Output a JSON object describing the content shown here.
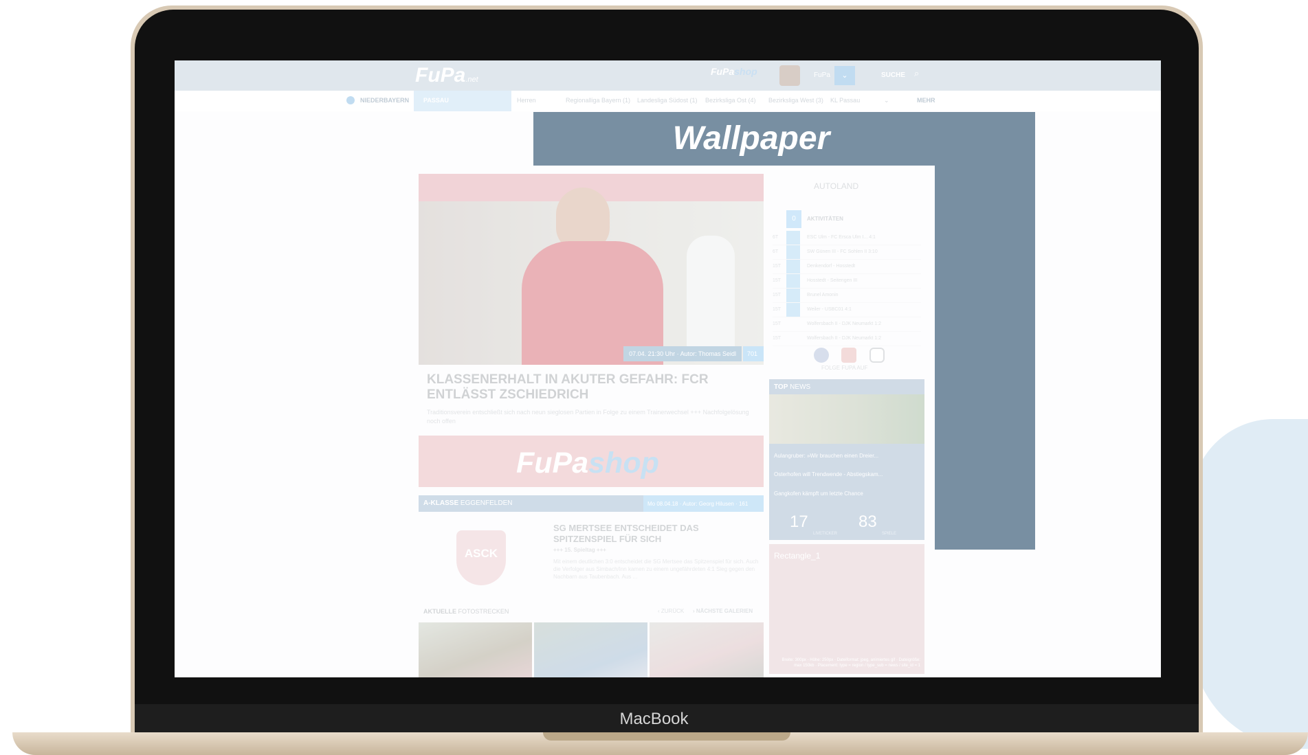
{
  "device": {
    "brand": "MacBook"
  },
  "header": {
    "logo_text": "FuPa",
    "logo_suffix": ".net",
    "shop_logo": [
      "FuPa",
      "shop"
    ],
    "user_label": "FuPa",
    "search_label": "SUCHE"
  },
  "subnav": {
    "region": "NIEDERBAYERN",
    "active": "PASSAU",
    "items": [
      "Herren",
      "Regionalliga Bayern (1)",
      "Landesliga Südost (1)",
      "Bezirksliga Ost (4)",
      "Bezirksliga West (3)",
      "KL Passau"
    ],
    "more": "MEHR"
  },
  "wallpaper": {
    "title": "Wallpaper"
  },
  "hero": {
    "meta": "07.04. 21:30 Uhr · Autor: Thomas Seidl",
    "meta_count": "701",
    "headline": "KLASSENERHALT IN AKUTER GEFAHR: FCR ENTLÄSST ZSCHIEDRICH",
    "teaser": "Traditionsverein entschließt sich nach neun sieglosen Partien in Folge zu einem Trainerwechsel +++ Nachfolgelösung noch offen"
  },
  "shop_banner": [
    "FuPa",
    "shop"
  ],
  "league": {
    "name_bold": "A-KLASSE",
    "name": "EGGENFELDEN",
    "info": "Mo 08.04.18 · Autor: Georg Hilusen · 161"
  },
  "article": {
    "badge": "ASCK",
    "title": "SG MERTSEE ENTSCHEIDET DAS SPITZENSPIEL FÜR SICH",
    "sub": "+++ 15. Spieltag +++",
    "text": "Mit einem deutlichen 3:0 entscheidet die SG Mertsee das Spitzenspiel für sich. Auch die Verfolger aus Simbach/Inn kamen zu einem ungefährdeten 4:1 Sieg gegen den Nachbarn aus Taubenbach. Aus ..."
  },
  "gallery": {
    "title_bold": "AKTUELLE",
    "title": "FOTOSTRECKEN",
    "back": "‹ ZURÜCK",
    "next": "› NÄCHSTE GALERIEN"
  },
  "sidebar": {
    "sponsor": "AUTOLAND",
    "activity_count": "0",
    "activity_label": "AKTIVITÄTEN",
    "activities": [
      {
        "time": "6T",
        "text": "ESC Ulm - FC Ersca Ulm I... 4:1"
      },
      {
        "time": "6T",
        "text": "SW Günen III - FC Sohlen II 3:10"
      },
      {
        "time": "15T",
        "text": "Denkendorf - Hosstedt"
      },
      {
        "time": "15T",
        "text": "Hosstedt - Seitengen III"
      },
      {
        "time": "15T",
        "text": "Brunel Amonin"
      },
      {
        "time": "15T",
        "text": "Weiler - USBC01 4:1"
      },
      {
        "time": "15T",
        "text": "Wolfersbach II - DJK Neumarkt 1:2"
      },
      {
        "time": "15T",
        "text": "Wolfersbach II - DJK Neumarkt 1:2"
      }
    ],
    "follow": "FOLGE FUPA AUF",
    "top_news": {
      "title_bold": "TOP",
      "title": "NEWS",
      "items": [
        "Aulangruber: »Wir brauchen einen Dreier...",
        "Osterhofen will Trendwende - Abstiegskam...",
        "Gangkofen kämpft um letzte Chance"
      ],
      "stat1": "17",
      "stat1_label": "LIVETICKER",
      "stat2": "83",
      "stat2_label": "SPIELE"
    },
    "rect": {
      "label": "Rectangle_1",
      "note": "Breite: 300px - Höhe: 250px · Dateiformat: jpeg, animiertes gif · Dateigröße: max 150kb · Placement: type = region / type_sub = news / site_id = 1"
    }
  }
}
